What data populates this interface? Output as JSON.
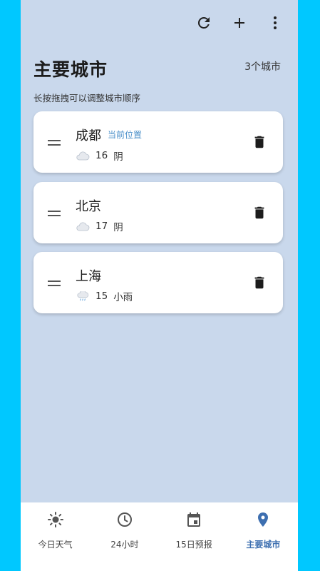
{
  "header": {
    "title": "主要城市",
    "city_count": "3个城市",
    "hint": "长按拖拽可以调整城市顺序",
    "actions": [
      {
        "name": "refresh-icon"
      },
      {
        "name": "add-icon"
      },
      {
        "name": "more-vert-icon"
      }
    ]
  },
  "cities": [
    {
      "name": "成都",
      "badge": "当前位置",
      "icon": "cloud-icon",
      "temp": "16",
      "condition": "阴"
    },
    {
      "name": "北京",
      "badge": "",
      "icon": "cloud-icon",
      "temp": "17",
      "condition": "阴"
    },
    {
      "name": "上海",
      "badge": "",
      "icon": "rain-cloud-icon",
      "temp": "15",
      "condition": "小雨"
    }
  ],
  "bottom_nav": {
    "items": [
      {
        "label": "今日天气",
        "icon": "sun-icon",
        "active": false
      },
      {
        "label": "24小时",
        "icon": "clock-icon",
        "active": false
      },
      {
        "label": "15日预报",
        "icon": "calendar-icon",
        "active": false
      },
      {
        "label": "主要城市",
        "icon": "location-pin-icon",
        "active": true
      }
    ]
  },
  "colors": {
    "background": "#c9d8ec",
    "accent": "#3d6fb0",
    "badge": "#4a8fc9",
    "frame": "#00c8ff"
  }
}
